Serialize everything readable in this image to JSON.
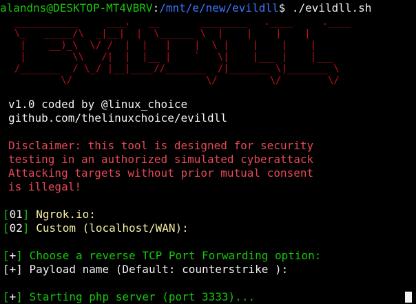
{
  "prompt": {
    "user_host": "alandns@DESKTOP-MT4VBRV",
    "sep": ":",
    "path": "/mnt/e/new/evildll",
    "suffix": "$ ",
    "command": "./evildll.sh"
  },
  "banner": {
    "text_red": "  ___________     ___.   __       ________   .____     .____    \n  \\_   _____/\\  _|__|  |  \\______ \\  |    |    |    |   \n   |    __)_\\  \\/ /  |  |   |    |  \\ |    |    |    |   \n   |        \\\\   /|  |  |__ |    `   \\|    |___ |    |___\n  /_______  / \\_/ |__|____//_______  /|_______ \\|_______ \\\n          \\/                       \\/         \\/        \\/",
    "text_yellow": ""
  },
  "info": {
    "version": "v1.0 coded by @linux_choice",
    "github": "github.com/thelinuxchoice/evildll"
  },
  "disclaimer": [
    "Disclaimer: this tool is designed for security",
    "testing in an authorized simulated cyberattack",
    "Attacking targets without prior mutual consent",
    "is illegal!"
  ],
  "menu": [
    {
      "num": "01",
      "label": "Ngrok.io:"
    },
    {
      "num": "02",
      "label": "Custom (localhost/WAN):"
    }
  ],
  "messages": {
    "port_option": "Choose a reverse TCP Port Forwarding option:",
    "payload_name": "Payload name (Default: counterstrike ):",
    "starting_php": "Starting php server (port 3333)..."
  },
  "colors": {
    "background": "#000000",
    "green": "#16c60c",
    "blue": "#3b78ff",
    "red": "#e74856",
    "text": "#f2f2f2"
  }
}
